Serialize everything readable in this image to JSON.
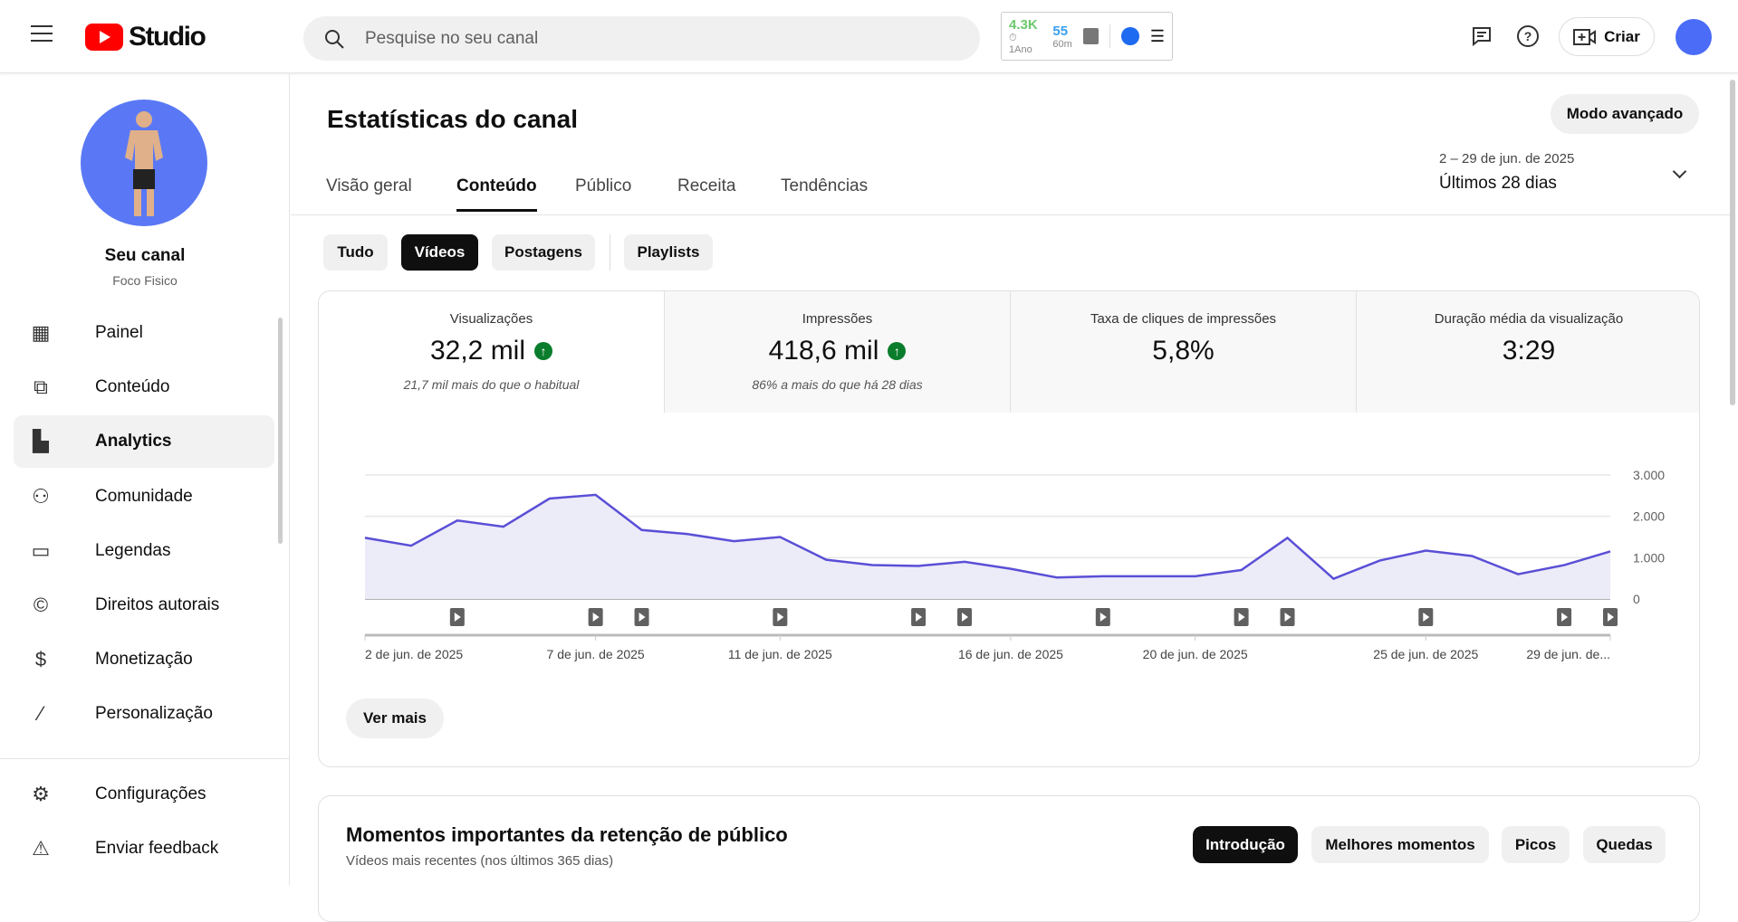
{
  "header": {
    "logo_text": "Studio",
    "search_placeholder": "Pesquise no seu canal",
    "ext": {
      "views": "4.3K",
      "period": "1Ano",
      "realtime": "55",
      "realtime_period": "60m"
    },
    "create_label": "Criar"
  },
  "sidebar": {
    "channel_name": "Seu canal",
    "channel_handle": "Foco Fisico",
    "items": [
      {
        "label": "Painel",
        "icon": "dashboard-icon"
      },
      {
        "label": "Conteúdo",
        "icon": "content-icon"
      },
      {
        "label": "Analytics",
        "icon": "analytics-icon"
      },
      {
        "label": "Comunidade",
        "icon": "community-icon"
      },
      {
        "label": "Legendas",
        "icon": "subtitles-icon"
      },
      {
        "label": "Direitos autorais",
        "icon": "copyright-icon"
      },
      {
        "label": "Monetização",
        "icon": "dollar-icon"
      },
      {
        "label": "Personalização",
        "icon": "magic-wand-icon"
      }
    ],
    "bottom": [
      {
        "label": "Configurações"
      },
      {
        "label": "Enviar feedback"
      }
    ]
  },
  "main": {
    "title": "Estatísticas do canal",
    "advanced_label": "Modo avançado",
    "tabs": [
      "Visão geral",
      "Conteúdo",
      "Público",
      "Receita",
      "Tendências"
    ],
    "date_range": "2 – 29 de jun. de 2025",
    "date_preset": "Últimos 28 dias",
    "chips": [
      "Tudo",
      "Vídeos",
      "Postagens",
      "Playlists"
    ],
    "metrics": [
      {
        "label": "Visualizações",
        "value": "32,2 mil",
        "sub": "21,7 mil mais do que o habitual"
      },
      {
        "label": "Impressões",
        "value": "418,6 mil",
        "sub": "86% a mais do que há 28 dias"
      },
      {
        "label": "Taxa de cliques de impressões",
        "value": "5,8%"
      },
      {
        "label": "Duração média da visualização",
        "value": "3:29"
      }
    ],
    "see_more": "Ver mais",
    "retention": {
      "title": "Momentos importantes da retenção de público",
      "subtitle": "Vídeos mais recentes (nos últimos 365 dias)",
      "buttons": [
        "Introdução",
        "Melhores momentos",
        "Picos",
        "Quedas"
      ]
    }
  },
  "colors": {
    "line": "#5a4fd6",
    "fill": "#ecebf8",
    "accent": "#ff0000"
  },
  "chart_data": {
    "type": "area",
    "series": [
      {
        "name": "Visualizações",
        "values": [
          1480,
          1290,
          1900,
          1750,
          2430,
          2520,
          1670,
          1570,
          1400,
          1500,
          950,
          820,
          800,
          900,
          730,
          520,
          550,
          550,
          550,
          700,
          1480,
          490,
          930,
          1170,
          1040,
          600,
          820,
          1150
        ]
      }
    ],
    "ylim": [
      0,
      3000
    ],
    "yticks": [
      "3.000",
      "2.000",
      "1.000",
      "0"
    ],
    "ytick_values": [
      3000,
      2000,
      1000,
      0
    ],
    "xticks": [
      {
        "day": 0,
        "label": "2 de jun. de 2025"
      },
      {
        "day": 5,
        "label": "7 de jun. de 2025"
      },
      {
        "day": 9,
        "label": "11 de jun. de 2025"
      },
      {
        "day": 14,
        "label": "16 de jun. de 2025"
      },
      {
        "day": 18,
        "label": "20 de jun. de 2025"
      },
      {
        "day": 23,
        "label": "25 de jun. de 2025"
      },
      {
        "day": 27,
        "label": "29 de jun. de..."
      }
    ],
    "video_markers": [
      2,
      5,
      6,
      9,
      12,
      13,
      16,
      19,
      20,
      23,
      26,
      27
    ]
  }
}
